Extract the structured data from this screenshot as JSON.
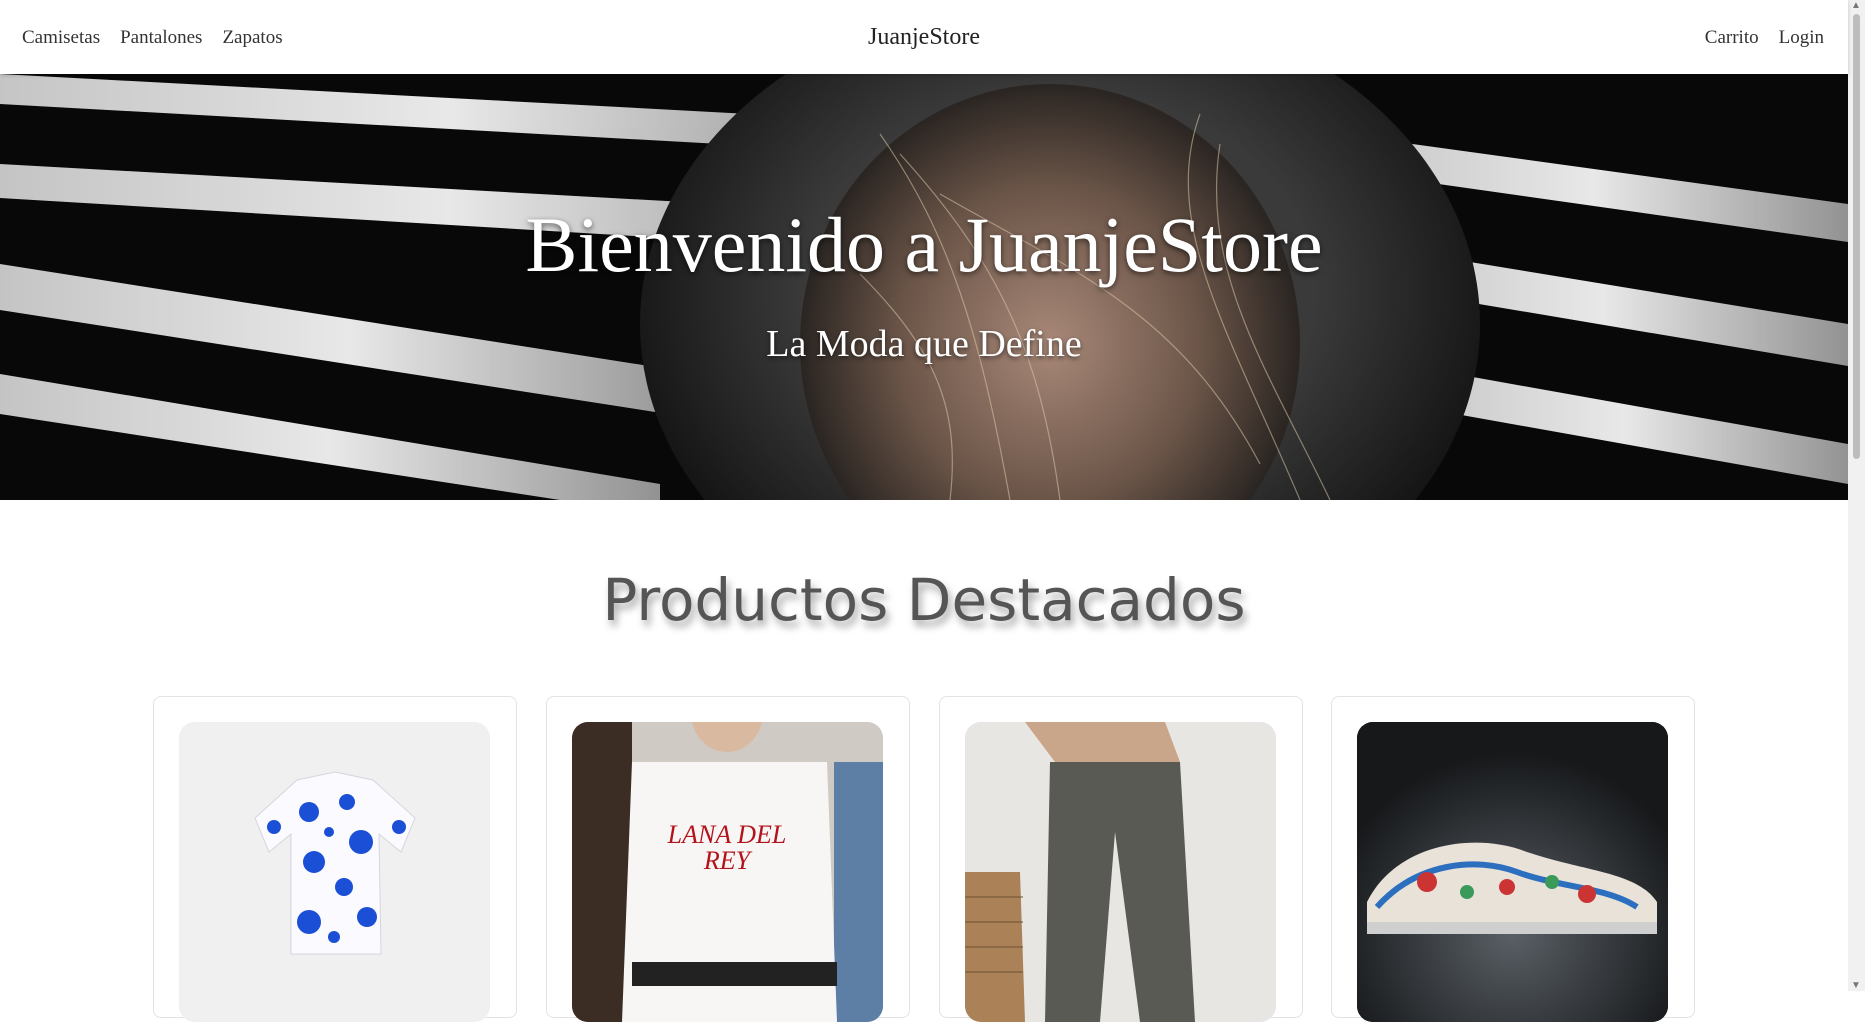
{
  "nav": {
    "left": [
      "Camisetas",
      "Pantalones",
      "Zapatos"
    ],
    "brand": "JuanjeStore",
    "right": [
      "Carrito",
      "Login"
    ]
  },
  "hero": {
    "title": "Bienvenido a JuanjeStore",
    "subtitle": "La Moda que Define"
  },
  "products": {
    "title": "Productos Destacados",
    "items": [
      {
        "image": "floral-shirt-photo"
      },
      {
        "image": "lana-del-rey-tshirt-photo",
        "print_text": "LANA DEL REY"
      },
      {
        "image": "cargo-pants-photo"
      },
      {
        "image": "sneakers-photo"
      }
    ]
  },
  "colors": {
    "hero_bg": "#0b0b0b",
    "shirt_print": "#1a4fd6",
    "tshirt_print": "#b3121b"
  }
}
